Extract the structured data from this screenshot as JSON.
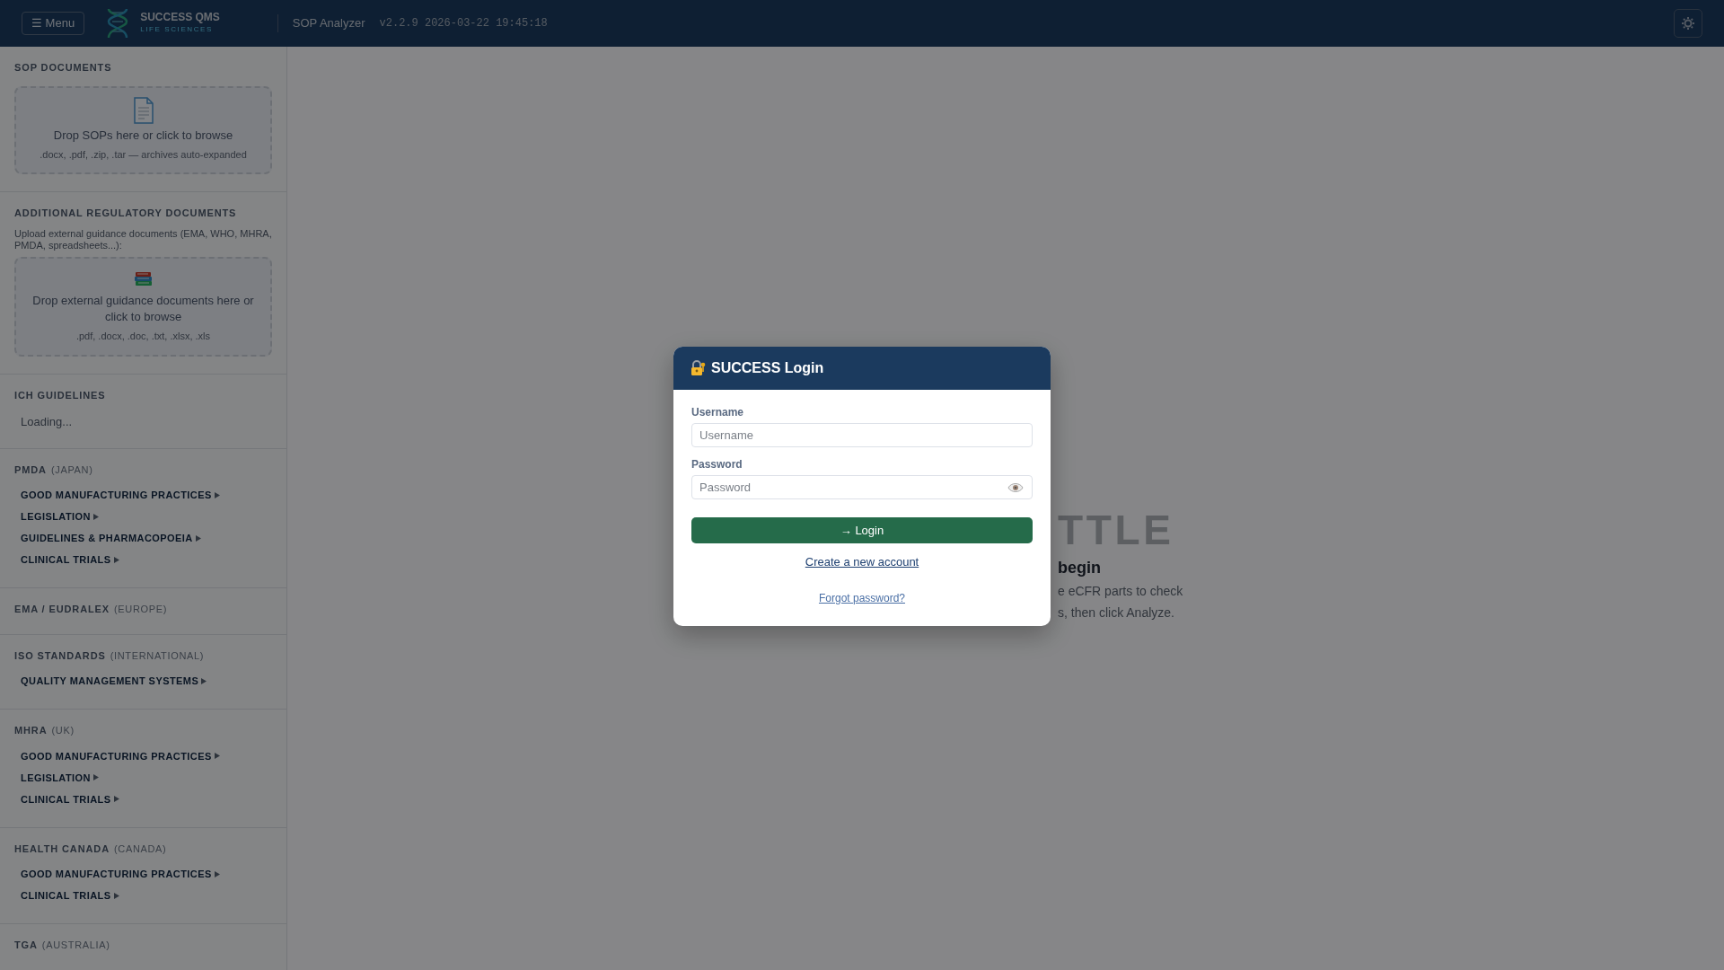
{
  "header": {
    "menu_button": "☰ Menu",
    "brand": "SUCCESS QMS",
    "brand_sub": "LIFE SCIENCES",
    "app_name": "SOP Analyzer",
    "version": "v2.2.9 2026-03-22 19:45:18"
  },
  "sidebar": {
    "sections": [
      {
        "kind": "dropzone",
        "title": "SOP DOCUMENTS",
        "drop_text": "Drop SOPs here or click to browse",
        "formats": ".docx, .pdf, .zip, .tar — archives auto-expanded"
      },
      {
        "kind": "dropzone",
        "title": "ADDITIONAL REGULATORY DOCUMENTS",
        "description": "Upload external guidance documents (EMA, WHO, MHRA, PMDA, spreadsheets...):",
        "drop_text": "Drop external guidance documents here or click to browse",
        "formats": ".pdf, .docx, .doc, .txt, .xlsx, .xls"
      },
      {
        "kind": "status",
        "title": "ICH GUIDELINES",
        "status": "Loading..."
      },
      {
        "kind": "group",
        "title": "PMDA",
        "region": "(JAPAN)",
        "items": [
          "GOOD MANUFACTURING PRACTICES",
          "LEGISLATION",
          "GUIDELINES & PHARMACOPOEIA",
          "CLINICAL TRIALS"
        ]
      },
      {
        "kind": "group",
        "title": "EMA / EUDRALEX",
        "region": "(EUROPE)"
      },
      {
        "kind": "group",
        "title": "ISO STANDARDS",
        "region": "(INTERNATIONAL)",
        "items": [
          "QUALITY MANAGEMENT SYSTEMS"
        ]
      },
      {
        "kind": "group",
        "title": "MHRA",
        "region": "(UK)",
        "items": [
          "GOOD MANUFACTURING PRACTICES",
          "LEGISLATION",
          "CLINICAL TRIALS"
        ]
      },
      {
        "kind": "group",
        "title": "HEALTH CANADA",
        "region": "(CANADA)",
        "items": [
          "GOOD MANUFACTURING PRACTICES",
          "CLINICAL TRIALS"
        ]
      },
      {
        "kind": "group",
        "title": "TGA",
        "region": "(AUSTRALIA)"
      }
    ]
  },
  "main": {
    "watermark": "TTLE",
    "heading": "begin",
    "lines": [
      "e eCFR parts to check",
      "s, then click Analyze."
    ]
  },
  "login": {
    "title": "SUCCESS Login",
    "fields": [
      {
        "label": "Username",
        "placeholder": "Username",
        "kind": "text"
      },
      {
        "label": "Password",
        "placeholder": "Password",
        "kind": "password"
      }
    ],
    "submit": "→ Login",
    "create_link": "Create a new account",
    "forgot_link": "Forgot password?"
  }
}
